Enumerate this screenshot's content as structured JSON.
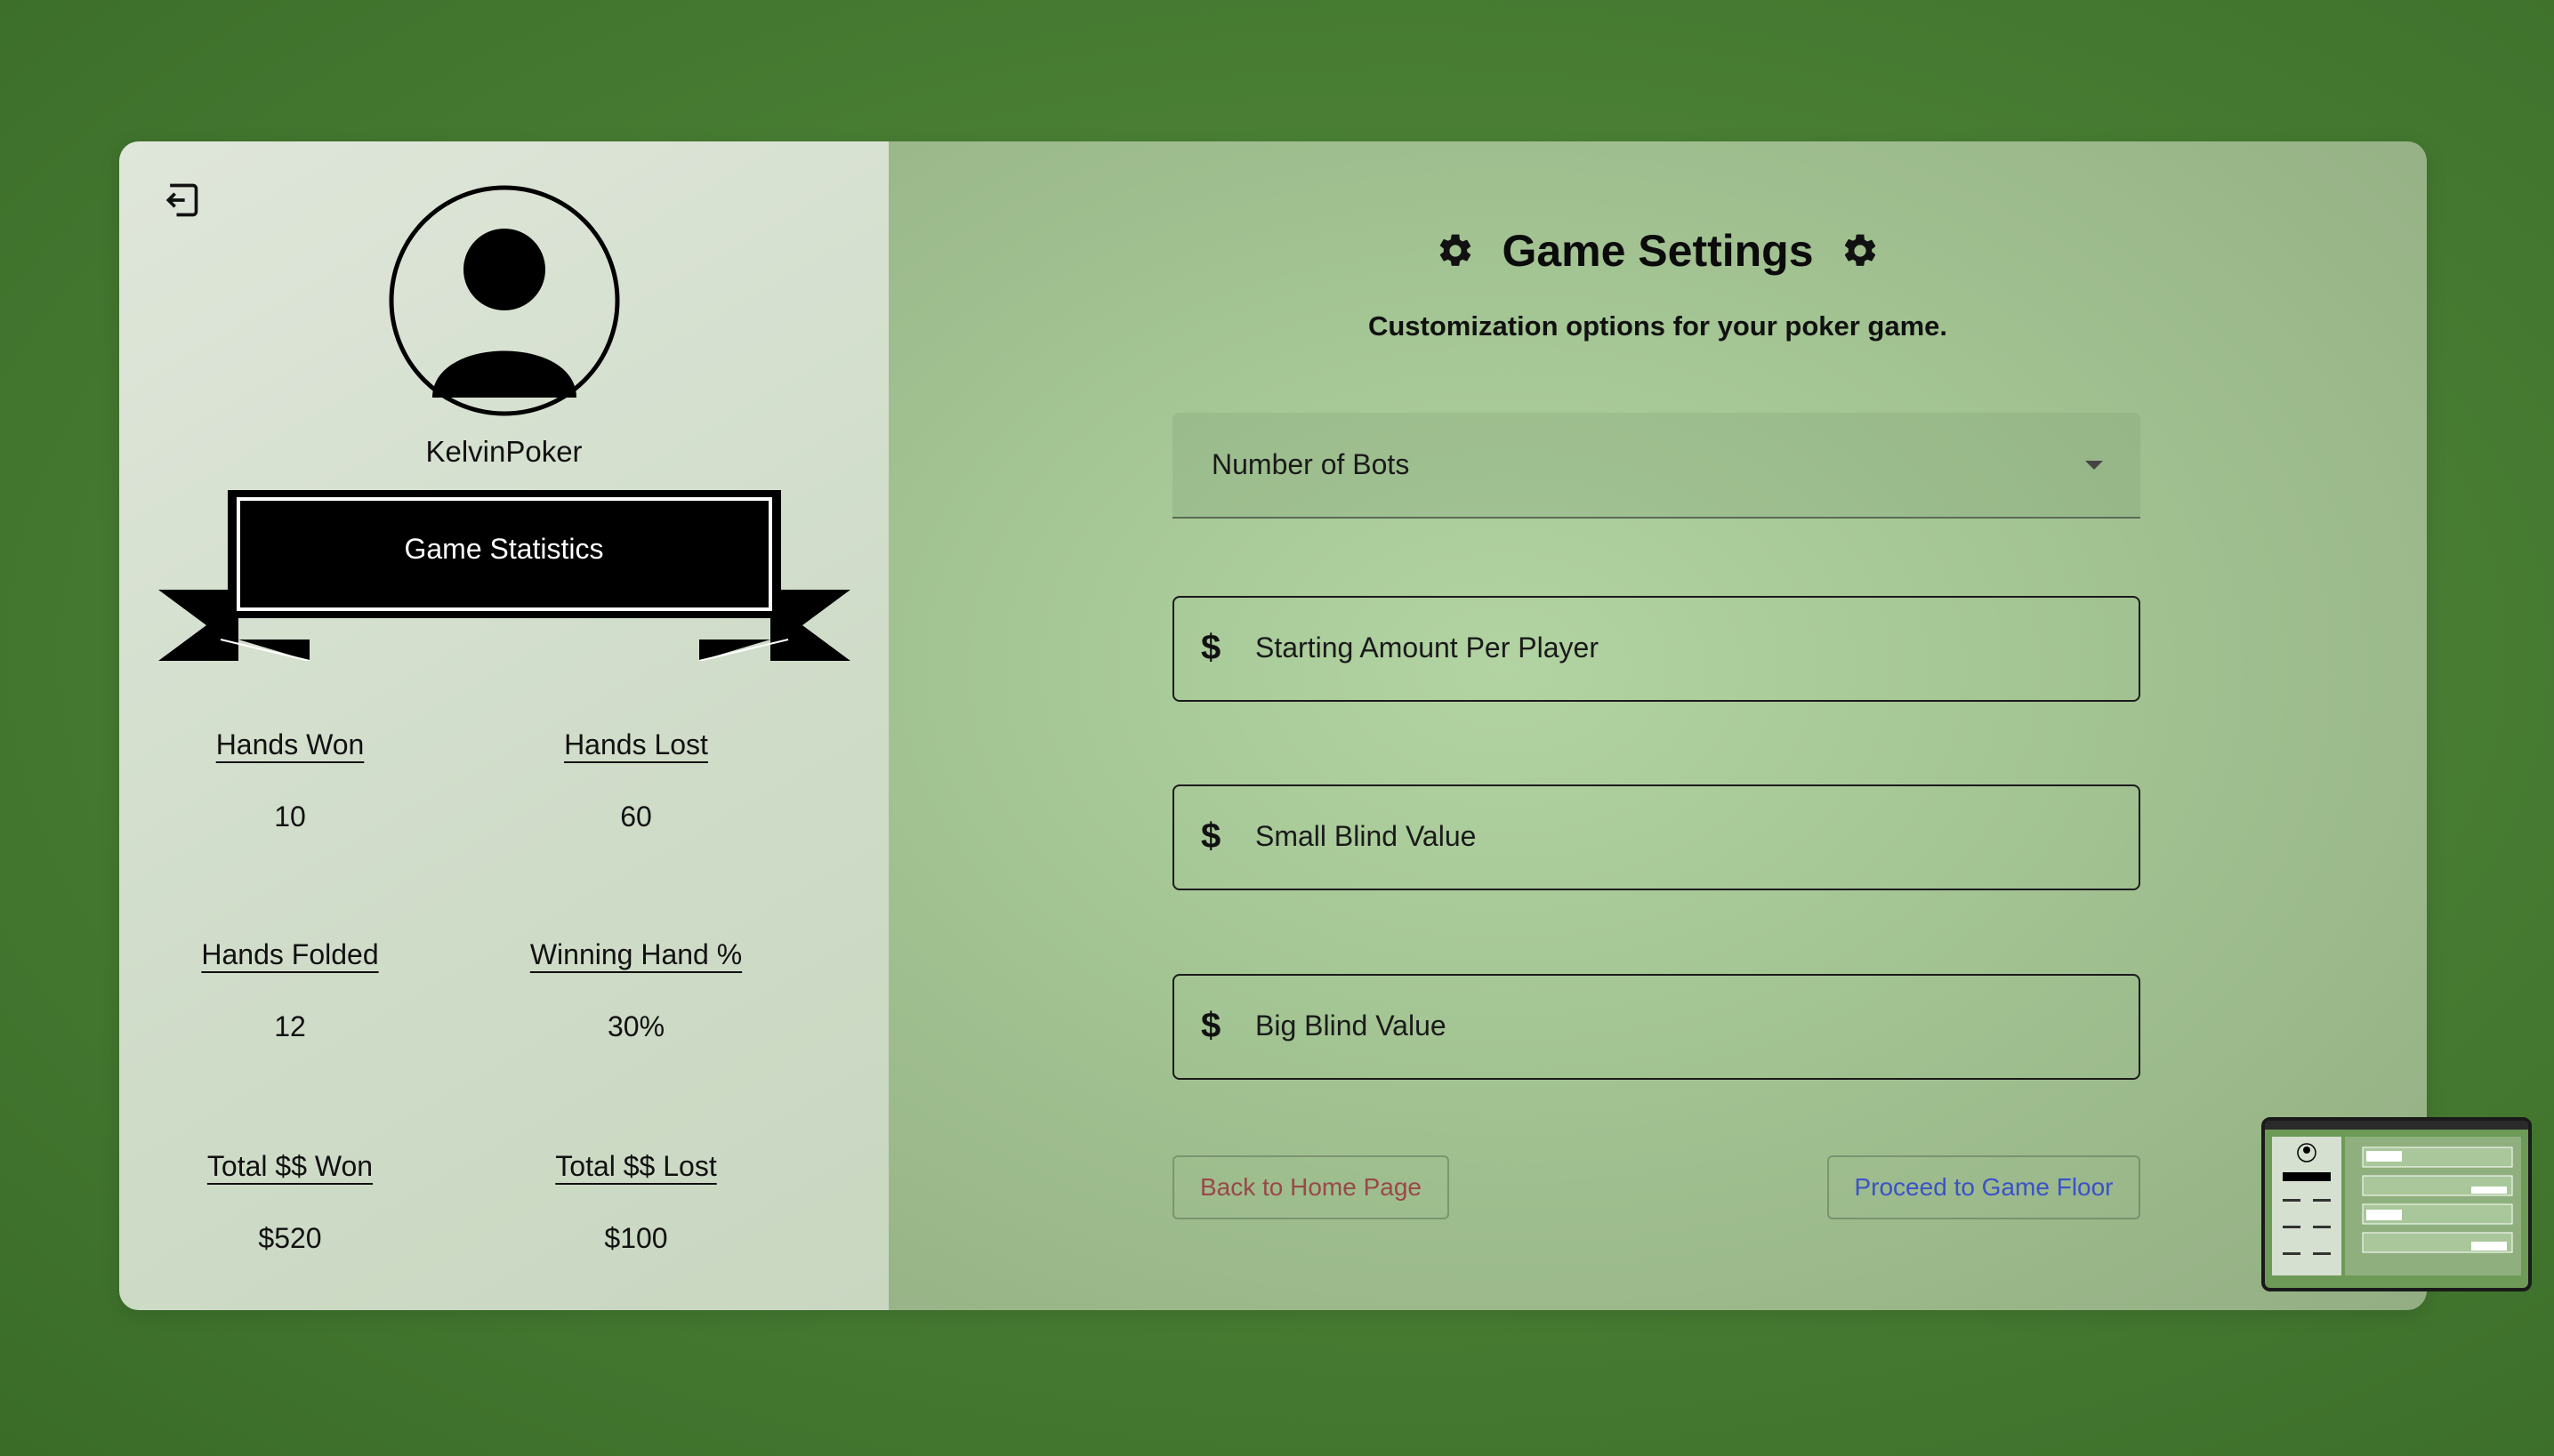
{
  "profile": {
    "username": "KelvinPoker",
    "banner_title": "Game Statistics",
    "stats": [
      {
        "label": "Hands Won",
        "value": "10"
      },
      {
        "label": "Hands Lost",
        "value": "60"
      },
      {
        "label": "Hands Folded",
        "value": "12"
      },
      {
        "label": "Winning Hand %",
        "value": "30%"
      },
      {
        "label": "Total $$ Won",
        "value": "$520"
      },
      {
        "label": "Total $$ Lost",
        "value": "$100"
      }
    ]
  },
  "settings": {
    "title": "Game Settings",
    "subtitle": "Customization options for your poker game.",
    "bots_select": "Number of Bots",
    "currency_symbol": "$",
    "fields": [
      {
        "label": "Starting Amount Per Player"
      },
      {
        "label": "Small Blind Value"
      },
      {
        "label": "Big Blind Value"
      }
    ],
    "back_button": "Back to Home Page",
    "proceed_button": "Proceed to Game Floor"
  },
  "colors": {
    "background": "#4a7f35",
    "back_button_text": "#9a4848",
    "proceed_button_text": "#3a52c8"
  },
  "icons": {
    "logout": "logout-icon",
    "avatar": "user-avatar-icon",
    "gear": "gear-icon",
    "dropdown": "chevron-down-icon",
    "dollar": "dollar-icon"
  }
}
